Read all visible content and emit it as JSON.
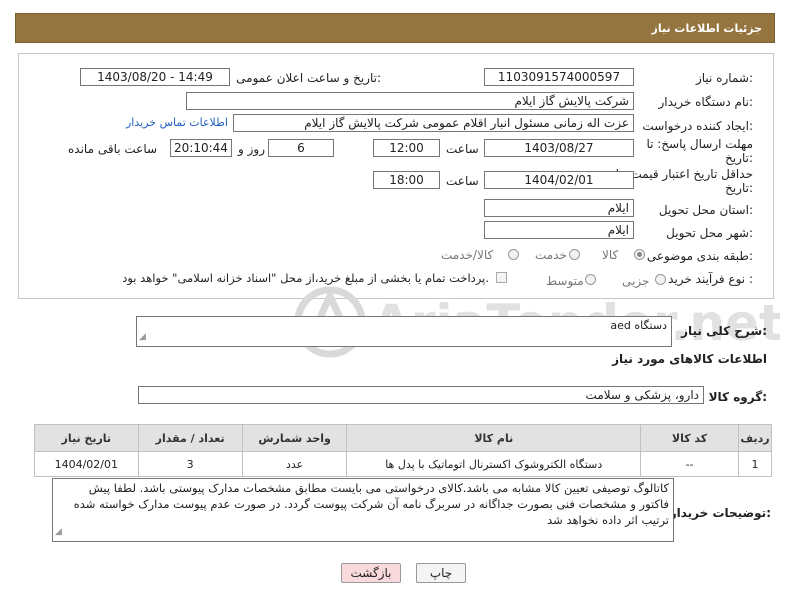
{
  "header": {
    "title": "جزئیات اطلاعات نیاز"
  },
  "form": {
    "need_number": {
      "label": "شماره نیاز:",
      "value": "1103091574000597"
    },
    "announce_datetime": {
      "label": "تاریخ و ساعت اعلان عمومی:",
      "value": "1403/08/20 - 14:49"
    },
    "buyer_org": {
      "label": "نام دستگاه خریدار:",
      "value": "شرکت پالایش گاز ایلام"
    },
    "requester": {
      "label": "ایجاد کننده درخواست:",
      "value": "عزت اله زمانی مسئول انبار اقلام عمومی شرکت پالایش گاز ایلام",
      "contact_link": "اطلاعات تماس خریدار"
    },
    "reply_deadline": {
      "label_line1": "مهلت ارسال پاسخ: تا",
      "label_line2": "تاریخ:",
      "date": "1403/08/27",
      "time_label": "ساعت",
      "time": "12:00",
      "days": "6",
      "days_label": "روز و",
      "remaining": "20:10:44",
      "remaining_label": "ساعت باقی مانده"
    },
    "price_validity": {
      "label_line1": "حداقل تاریخ اعتبار قیمت: تا",
      "label_line2": "تاریخ:",
      "date": "1404/02/01",
      "time_label": "ساعت",
      "time": "18:00"
    },
    "delivery_province": {
      "label": "استان محل تحویل:",
      "value": "ایلام"
    },
    "delivery_city": {
      "label": "شهر محل تحویل:",
      "value": "ایلام"
    },
    "category": {
      "label": "طبقه بندی موضوعی:",
      "options": [
        "کالا",
        "خدمت",
        "کالا/خدمت"
      ],
      "selected": "کالا"
    },
    "purchase_type": {
      "label": "نوع فرآیند خرید :",
      "options": [
        "جزیی",
        "متوسط"
      ],
      "selected": "",
      "treasury_note": "پرداخت تمام یا بخشی از مبلغ خرید،از محل \"اسناد خزانه اسلامی\" خواهد بود."
    }
  },
  "description": {
    "label": "شرح کلی نیاز:",
    "value": "دستگاه aed"
  },
  "items_title": "اطلاعات کالاهای مورد نیاز",
  "goods_group": {
    "label": "گروه کالا:",
    "value": "دارو، پزشکی و سلامت"
  },
  "table": {
    "headers": [
      "ردیف",
      "کد کالا",
      "نام کالا",
      "واحد شمارش",
      "تعداد / مقدار",
      "تاریخ نیاز"
    ],
    "rows": [
      [
        "1",
        "--",
        "دستگاه الکتروشوک اکسترنال اتوماتیک با پدل ها",
        "عدد",
        "3",
        "1404/02/01"
      ]
    ]
  },
  "buyer_notes": {
    "label": "توضیحات خریدار:",
    "value": "کاتالوگ توصیفی تعیین کالا مشابه می باشد.کالای درخواستی می بایست مطابق مشخصات مدارک پیوستی باشد. لطفا پیش فاکتور و مشخصات فنی بصورت جداگانه  در سربرگ نامه آن شرکت پیوست گردد. در صورت عدم پیوست مدارک خواسته شده ترتیب اثر داده نخواهد شد"
  },
  "buttons": {
    "print": "چاپ",
    "back": "بازگشت"
  },
  "watermark": {
    "text": "AriaTender.net"
  }
}
